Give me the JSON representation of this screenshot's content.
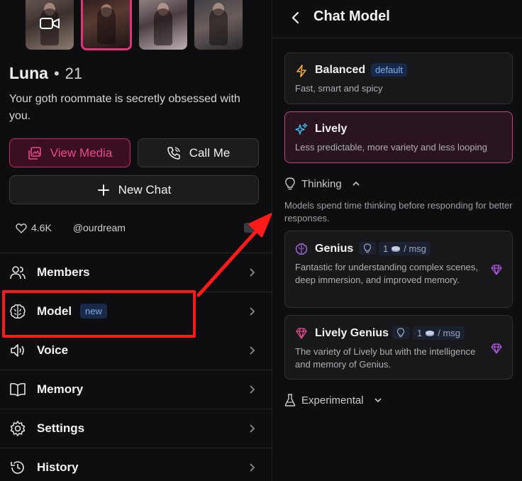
{
  "profile": {
    "name": "Luna",
    "separator": "•",
    "age": "21",
    "bio": "Your goth roommate is secretly obsessed with you.",
    "likes": "4.6K",
    "handle": "@ourdream"
  },
  "actions": {
    "view_media": "View Media",
    "call_me": "Call Me",
    "new_chat": "New Chat"
  },
  "menu": {
    "members": "Members",
    "model": "Model",
    "model_badge": "new",
    "voice": "Voice",
    "memory": "Memory",
    "settings": "Settings",
    "history": "History"
  },
  "chat_model": {
    "title": "Chat Model",
    "balanced": {
      "name": "Balanced",
      "badge": "default",
      "desc": "Fast, smart and spicy"
    },
    "lively": {
      "name": "Lively",
      "desc": "Less predictable, more variety and less looping"
    },
    "thinking": {
      "label": "Thinking",
      "desc": "Models spend time thinking before responding for better responses.",
      "genius": {
        "name": "Genius",
        "cost": "1",
        "cost_unit": "/ msg",
        "desc": "Fantastic for understanding complex scenes, deep immersion, and improved memory."
      },
      "lively_genius": {
        "name": "Lively Genius",
        "cost": "1",
        "cost_unit": "/ msg",
        "desc": "The variety of Lively but with the intelligence and memory of Genius."
      }
    },
    "experimental": "Experimental"
  },
  "colors": {
    "accent_pink": "#e2347c",
    "highlight_red": "#ff1a1a",
    "badge_blue": "#17294a"
  },
  "icons": [
    "video-icon",
    "image-icon",
    "phone-icon",
    "plus-icon",
    "heart-icon",
    "users-icon",
    "brain-icon",
    "speaker-icon",
    "book-icon",
    "gear-icon",
    "history-icon",
    "chevron-right-icon",
    "back-icon",
    "lightning-icon",
    "sparkle-icon",
    "lightbulb-icon",
    "chevron-up-icon",
    "chevron-down-icon",
    "flask-icon",
    "gem-icon",
    "credits-icon"
  ]
}
